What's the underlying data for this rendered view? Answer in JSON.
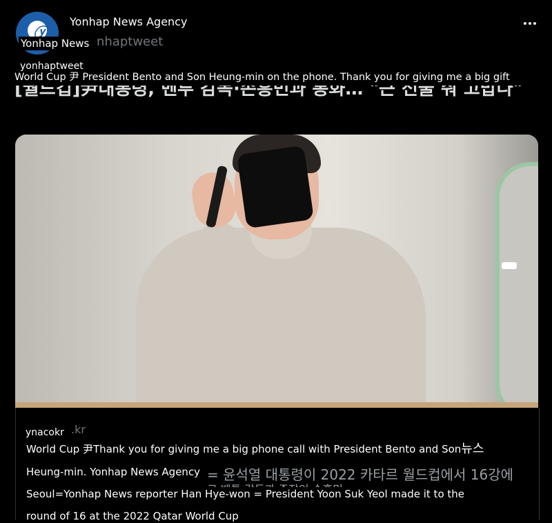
{
  "tweet": {
    "display_name": "Yonhap News Agency",
    "avatar_label": "Yonhap News",
    "handle_ghost": "nhaptweet",
    "handle": "yonhaptweet",
    "translated_text": "World Cup 尹 President Bento and Son Heung-min on the phone. Thank you for giving me a big gift",
    "original_text_visible": "[월드컵]尹대통령, 벤투 감독·손흥민과 통화… \"큰 선물 줘 고맙다\"",
    "more_icon": "more-horizontal-icon"
  },
  "link_card": {
    "domain": "ynacokr",
    "domain_ghost": ".kr",
    "title_line": "World Cup 尹Thank you for giving me a big phone call with President Bento and Son",
    "title_suffix": "뉴스",
    "desc_line_1": "Heung-min. Yonhap News Agency",
    "desc_ghost_1": "= 윤석열 대통령이 2022 카타르 월드컵에서 16강에",
    "desc_line_2": "Seoul=Yonhap News reporter Han Hye-won = President Yoon Suk Yeol made it to the",
    "desc_ghost_2": "르 벤투 감독과 주장인 손흥민",
    "desc_line_3": "round of 16 at the 2022 Qatar World Cup"
  },
  "colors": {
    "background": "#000000",
    "text": "#e7e9ea",
    "muted": "#71767b",
    "brand": "#1d5ea8"
  }
}
